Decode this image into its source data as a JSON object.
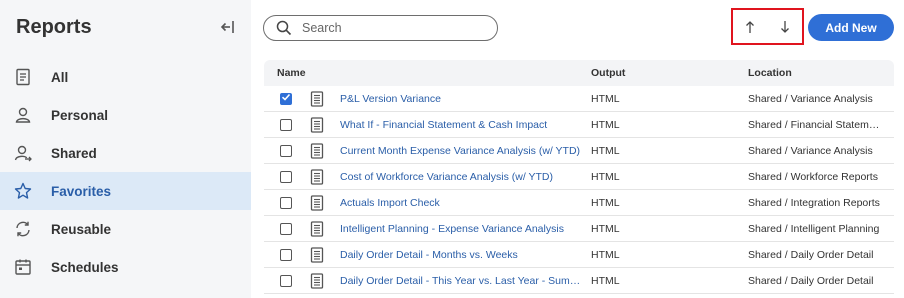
{
  "sidebar": {
    "title": "Reports",
    "items": [
      {
        "label": "All",
        "icon": "document-icon",
        "active": false
      },
      {
        "label": "Personal",
        "icon": "person-icon",
        "active": false
      },
      {
        "label": "Shared",
        "icon": "shared-person-icon",
        "active": false
      },
      {
        "label": "Favorites",
        "icon": "star-icon",
        "active": true
      },
      {
        "label": "Reusable",
        "icon": "refresh-icon",
        "active": false
      },
      {
        "label": "Schedules",
        "icon": "calendar-icon",
        "active": false
      }
    ]
  },
  "search": {
    "placeholder": "Search"
  },
  "toolbar": {
    "add_label": "Add New",
    "sort_up_icon": "arrow-up-icon",
    "sort_down_icon": "arrow-down-icon"
  },
  "table": {
    "headers": {
      "name": "Name",
      "output": "Output",
      "location": "Location"
    },
    "rows": [
      {
        "checked": true,
        "name": "P&L Version Variance",
        "output": "HTML",
        "location": "Shared / Variance Analysis"
      },
      {
        "checked": false,
        "name": "What If - Financial Statement & Cash Impact",
        "output": "HTML",
        "location": "Shared / Financial Statement Reports"
      },
      {
        "checked": false,
        "name": "Current Month Expense Variance Analysis (w/ YTD)",
        "output": "HTML",
        "location": "Shared / Variance Analysis"
      },
      {
        "checked": false,
        "name": "Cost of Workforce Variance Analysis (w/ YTD)",
        "output": "HTML",
        "location": "Shared / Workforce Reports"
      },
      {
        "checked": false,
        "name": "Actuals Import Check",
        "output": "HTML",
        "location": "Shared / Integration Reports"
      },
      {
        "checked": false,
        "name": "Intelligent Planning - Expense Variance Analysis",
        "output": "HTML",
        "location": "Shared / Intelligent Planning"
      },
      {
        "checked": false,
        "name": "Daily Order Detail - Months vs. Weeks",
        "output": "HTML",
        "location": "Shared / Daily Order Detail"
      },
      {
        "checked": false,
        "name": "Daily Order Detail - This Year vs. Last Year - Summary",
        "output": "HTML",
        "location": "Shared / Daily Order Detail"
      }
    ]
  },
  "colors": {
    "accent": "#2f6fd6",
    "highlight_border": "#e0141e",
    "active_nav_bg": "#dce9f7"
  }
}
